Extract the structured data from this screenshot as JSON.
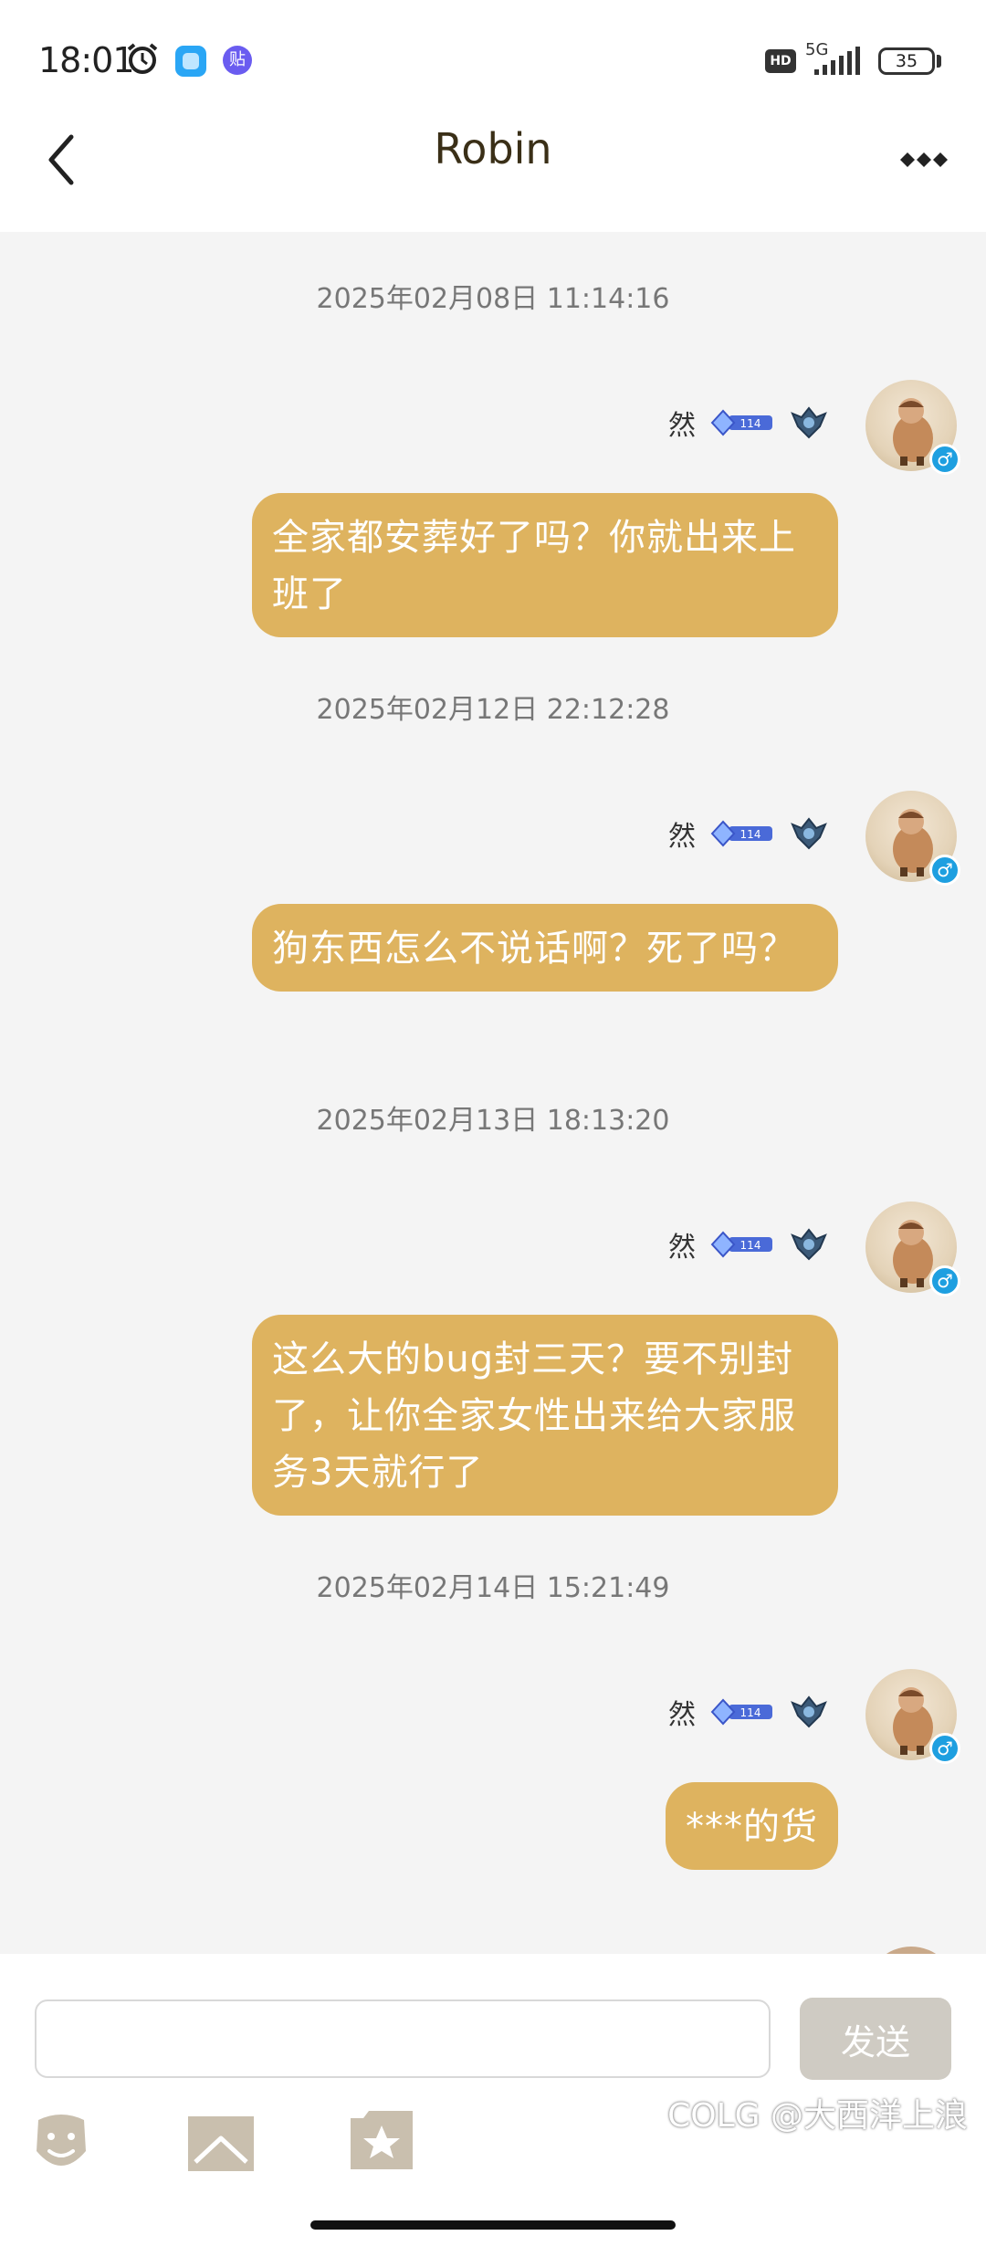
{
  "status_bar": {
    "time": "18:01",
    "network": "5G",
    "hd": "HD",
    "battery": "35",
    "icons": [
      "alarm-icon",
      "app-icon",
      "tieba-icon",
      "signal-icon",
      "battery-icon"
    ],
    "app2_label": "贴"
  },
  "header": {
    "title": "Robin",
    "back_icon": "chevron-left-icon",
    "more_icon": "more-dots-icon"
  },
  "messages": [
    {
      "timestamp": "2025年02月08日 11:14:16",
      "sender": "然",
      "text": "全家都安葬好了吗？你就出来上班了"
    },
    {
      "timestamp": "2025年02月12日 22:12:28",
      "sender": "然",
      "text": "狗东西怎么不说话啊？死了吗？"
    },
    {
      "timestamp": "2025年02月13日 18:13:20",
      "sender": "然",
      "text": "这么大的bug封三天？要不别封了，让你全家女性出来给大家服务3天就行了"
    },
    {
      "timestamp": "2025年02月14日 15:21:49",
      "sender": "然",
      "text": "***的货"
    }
  ],
  "badge": {
    "level_text": "114",
    "gender_symbol": "♂"
  },
  "composer": {
    "input_value": "",
    "input_placeholder": "",
    "send_label": "发送",
    "tools": [
      "emoji-icon",
      "image-icon",
      "sticker-icon"
    ]
  },
  "watermark": "COLG @大西洋上浪",
  "colors": {
    "bubble": "#deb35f",
    "background": "#f4f4f4",
    "send_button": "#cfcbc3",
    "gender_badge": "#1e9fe0"
  }
}
